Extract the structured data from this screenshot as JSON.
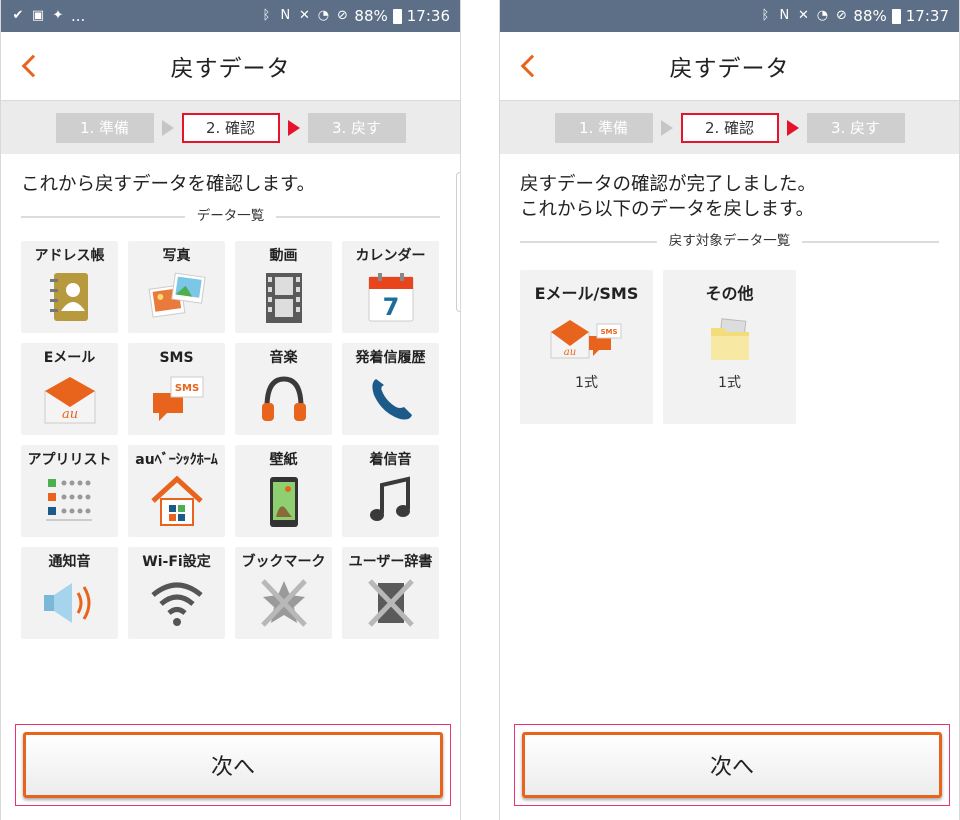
{
  "left": {
    "status": {
      "battery": "88%",
      "time": "17:36",
      "dots": "..."
    },
    "title": "戻すデータ",
    "steps": [
      "1. 準備",
      "2. 確認",
      "3. 戻す"
    ],
    "message": "これから戻すデータを確認します。",
    "section": "データ一覧",
    "tiles": [
      {
        "label": "アドレス帳",
        "icon": "address-book-icon"
      },
      {
        "label": "写真",
        "icon": "photos-icon"
      },
      {
        "label": "動画",
        "icon": "film-icon"
      },
      {
        "label": "カレンダー",
        "icon": "calendar-icon"
      },
      {
        "label": "Eメール",
        "icon": "email-icon"
      },
      {
        "label": "SMS",
        "icon": "sms-icon"
      },
      {
        "label": "音楽",
        "icon": "headphones-icon"
      },
      {
        "label": "発着信履歴",
        "icon": "phone-icon"
      },
      {
        "label": "アプリリスト",
        "icon": "app-list-icon"
      },
      {
        "label": "auﾍﾞｰｼｯｸﾎｰﾑ",
        "icon": "home-icon"
      },
      {
        "label": "壁紙",
        "icon": "wallpaper-icon"
      },
      {
        "label": "着信音",
        "icon": "music-note-icon"
      },
      {
        "label": "通知音",
        "icon": "speaker-icon"
      },
      {
        "label": "Wi-Fi設定",
        "icon": "wifi-icon"
      },
      {
        "label": "ブックマーク",
        "icon": "bookmark-disabled-icon"
      },
      {
        "label": "ユーザー辞書",
        "icon": "dictionary-disabled-icon"
      }
    ],
    "next": "次へ"
  },
  "right": {
    "status": {
      "battery": "88%",
      "time": "17:37"
    },
    "title": "戻すデータ",
    "steps": [
      "1. 準備",
      "2. 確認",
      "3. 戻す"
    ],
    "message_line1": "戻すデータの確認が完了しました。",
    "message_line2": "これから以下のデータを戻します。",
    "section": "戻す対象データ一覧",
    "tiles": [
      {
        "label": "Eメール/SMS",
        "count": "1式",
        "icon": "email-sms-icon"
      },
      {
        "label": "その他",
        "count": "1式",
        "icon": "folder-icon"
      }
    ],
    "next": "次へ"
  },
  "colors": {
    "accent": "#e8641c",
    "step_active": "#e3142c",
    "statusbar": "#5d6f86"
  }
}
